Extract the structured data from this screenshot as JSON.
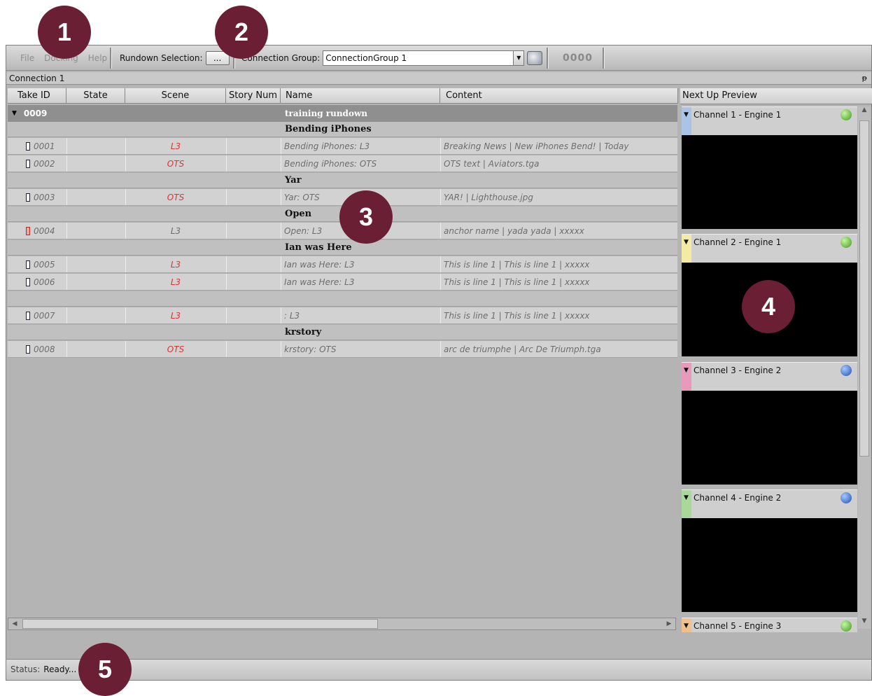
{
  "menu": [
    "File",
    "Docking",
    "Help"
  ],
  "toolbar": {
    "rundown_label": "Rundown Selection:",
    "rundown_button": "...",
    "connection_group_label": "Connection Group:",
    "connection_group_value": "ConnectionGroup 1",
    "counter": "0000"
  },
  "panel": {
    "title": "Connection 1",
    "pin": "ᵽ"
  },
  "table": {
    "columns": [
      "Take ID",
      "State",
      "Scene",
      "Story Num",
      "Name",
      "Content"
    ],
    "root": {
      "take_id": "0009",
      "name": "training rundown"
    },
    "rows": [
      {
        "type": "group",
        "label": "Bending iPhones"
      },
      {
        "type": "item",
        "take_id": "0001",
        "scene": "L3",
        "scene_red": true,
        "name": "Bending iPhones: L3",
        "content": "Breaking News | New iPhones Bend! | Today",
        "icon": "normal"
      },
      {
        "type": "item",
        "take_id": "0002",
        "scene": "OTS",
        "scene_red": true,
        "name": "Bending iPhones: OTS",
        "content": "OTS text | Aviators.tga",
        "icon": "normal"
      },
      {
        "type": "group",
        "label": "Yar"
      },
      {
        "type": "item",
        "take_id": "0003",
        "scene": "OTS",
        "scene_red": true,
        "name": "Yar: OTS",
        "content": "YAR! | Lighthouse.jpg",
        "icon": "normal"
      },
      {
        "type": "group",
        "label": "Open"
      },
      {
        "type": "item",
        "take_id": "0004",
        "scene": "L3",
        "scene_red": false,
        "name": "Open: L3",
        "content": "anchor name | yada yada | xxxxx",
        "icon": "red"
      },
      {
        "type": "group",
        "label": "Ian was Here"
      },
      {
        "type": "item",
        "take_id": "0005",
        "scene": "L3",
        "scene_red": true,
        "name": "Ian was Here: L3",
        "content": "This is line 1 | This is line 1 | xxxxx",
        "icon": "normal"
      },
      {
        "type": "item",
        "take_id": "0006",
        "scene": "L3",
        "scene_red": true,
        "name": "Ian was Here: L3",
        "content": "This is line 1 | This is line 1 | xxxxx",
        "icon": "normal"
      },
      {
        "type": "group",
        "label": ""
      },
      {
        "type": "item",
        "take_id": "0007",
        "scene": "L3",
        "scene_red": true,
        "name": ": L3",
        "content": "This is line 1 | This is line 1 | xxxxx",
        "icon": "normal"
      },
      {
        "type": "group",
        "label": "krstory"
      },
      {
        "type": "item",
        "take_id": "0008",
        "scene": "OTS",
        "scene_red": true,
        "name": "krstory: OTS",
        "content": "arc de triumphe | Arc De Triumph.tga",
        "icon": "normal"
      }
    ]
  },
  "preview": {
    "title": "Next Up Preview",
    "channels": [
      {
        "label": "Channel 1 - Engine 1",
        "stripe": "#a9c4e6",
        "status": "green"
      },
      {
        "label": "Channel 2 - Engine 1",
        "stripe": "#f3eaa4",
        "status": "green"
      },
      {
        "label": "Channel 3 - Engine 2",
        "stripe": "#e79abb",
        "status": "blue"
      },
      {
        "label": "Channel 4 - Engine 2",
        "stripe": "#a8d89a",
        "status": "blue"
      },
      {
        "label": "Channel 5 - Engine 3",
        "stripe": "#f2c08a",
        "status": "green"
      }
    ]
  },
  "status": {
    "key": "Status:",
    "value": "Ready..."
  },
  "callouts": [
    "1",
    "2",
    "3",
    "4",
    "5"
  ],
  "colors": {
    "callout": "#6b1f34",
    "scene_red": "#d33333"
  }
}
